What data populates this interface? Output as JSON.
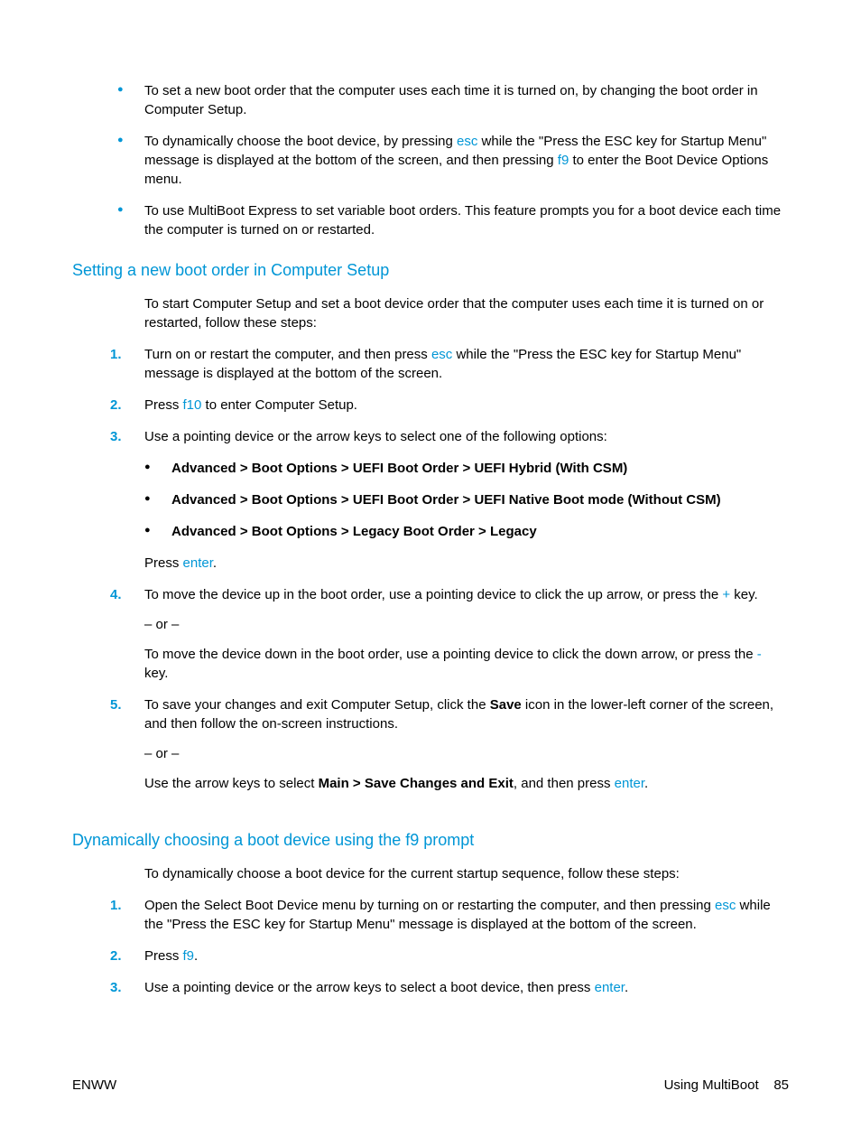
{
  "bullets_top": [
    {
      "pre": "To set a new boot order that the computer uses each time it is turned on, by changing the boot order in Computer Setup."
    },
    {
      "parts": [
        {
          "t": "To dynamically choose the boot device, by pressing "
        },
        {
          "t": "esc",
          "key": true
        },
        {
          "t": " while the \"Press the ESC key for Startup Menu\" message is displayed at the bottom of the screen, and then pressing "
        },
        {
          "t": "f9",
          "key": true
        },
        {
          "t": " to enter the Boot Device Options menu."
        }
      ]
    },
    {
      "pre": "To use MultiBoot Express to set variable boot orders. This feature prompts you for a boot device each time the computer is turned on or restarted."
    }
  ],
  "h_setting": "Setting a new boot order in Computer Setup",
  "p_setting_intro": "To start Computer Setup and set a boot device order that the computer uses each time it is turned on or restarted, follow these steps:",
  "steps1": [
    {
      "parts": [
        {
          "t": "Turn on or restart the computer, and then press "
        },
        {
          "t": "esc",
          "key": true
        },
        {
          "t": " while the \"Press the ESC key for Startup Menu\" message is displayed at the bottom of the screen."
        }
      ]
    },
    {
      "parts": [
        {
          "t": "Press "
        },
        {
          "t": "f10",
          "key": true
        },
        {
          "t": " to enter Computer Setup."
        }
      ]
    },
    {
      "main": "Use a pointing device or the arrow keys to select one of the following options:",
      "sub_bullets": [
        "Advanced > Boot Options > UEFI Boot Order > UEFI Hybrid (With CSM)",
        "Advanced > Boot Options > UEFI Boot Order > UEFI Native Boot mode (Without CSM)",
        "Advanced > Boot Options > Legacy Boot Order > Legacy"
      ],
      "after_parts": [
        {
          "t": "Press "
        },
        {
          "t": "enter",
          "key": true
        },
        {
          "t": "."
        }
      ]
    },
    {
      "parts": [
        {
          "t": "To move the device up in the boot order, use a pointing device to click the up arrow, or press the "
        },
        {
          "t": "+",
          "key": true
        },
        {
          "t": " key."
        }
      ],
      "sub_paras": [
        {
          "plain": "– or –"
        },
        {
          "parts": [
            {
              "t": "To move the device down in the boot order, use a pointing device to click the down arrow, or press the "
            },
            {
              "t": "-",
              "key": true
            },
            {
              "t": " key."
            }
          ]
        }
      ]
    },
    {
      "parts": [
        {
          "t": "To save your changes and exit Computer Setup, click the "
        },
        {
          "t": "Save",
          "bold": true
        },
        {
          "t": " icon in the lower-left corner of the screen, and then follow the on-screen instructions."
        }
      ],
      "sub_paras": [
        {
          "plain": "– or –"
        },
        {
          "parts": [
            {
              "t": "Use the arrow keys to select "
            },
            {
              "t": "Main > Save Changes and Exit",
              "bold": true
            },
            {
              "t": ", and then press "
            },
            {
              "t": "enter",
              "key": true
            },
            {
              "t": "."
            }
          ]
        }
      ]
    }
  ],
  "h_dyn": "Dynamically choosing a boot device using the f9 prompt",
  "p_dyn_intro": "To dynamically choose a boot device for the current startup sequence, follow these steps:",
  "steps2": [
    {
      "parts": [
        {
          "t": "Open the Select Boot Device menu by turning on or restarting the computer, and then pressing "
        },
        {
          "t": "esc",
          "key": true
        },
        {
          "t": " while the \"Press the ESC key for Startup Menu\" message is displayed at the bottom of the screen."
        }
      ]
    },
    {
      "parts": [
        {
          "t": "Press "
        },
        {
          "t": "f9",
          "key": true
        },
        {
          "t": "."
        }
      ]
    },
    {
      "parts": [
        {
          "t": "Use a pointing device or the arrow keys to select a boot device, then press "
        },
        {
          "t": "enter",
          "key": true
        },
        {
          "t": "."
        }
      ]
    }
  ],
  "footer": {
    "left": "ENWW",
    "right_label": "Using MultiBoot",
    "page_num": "85"
  }
}
